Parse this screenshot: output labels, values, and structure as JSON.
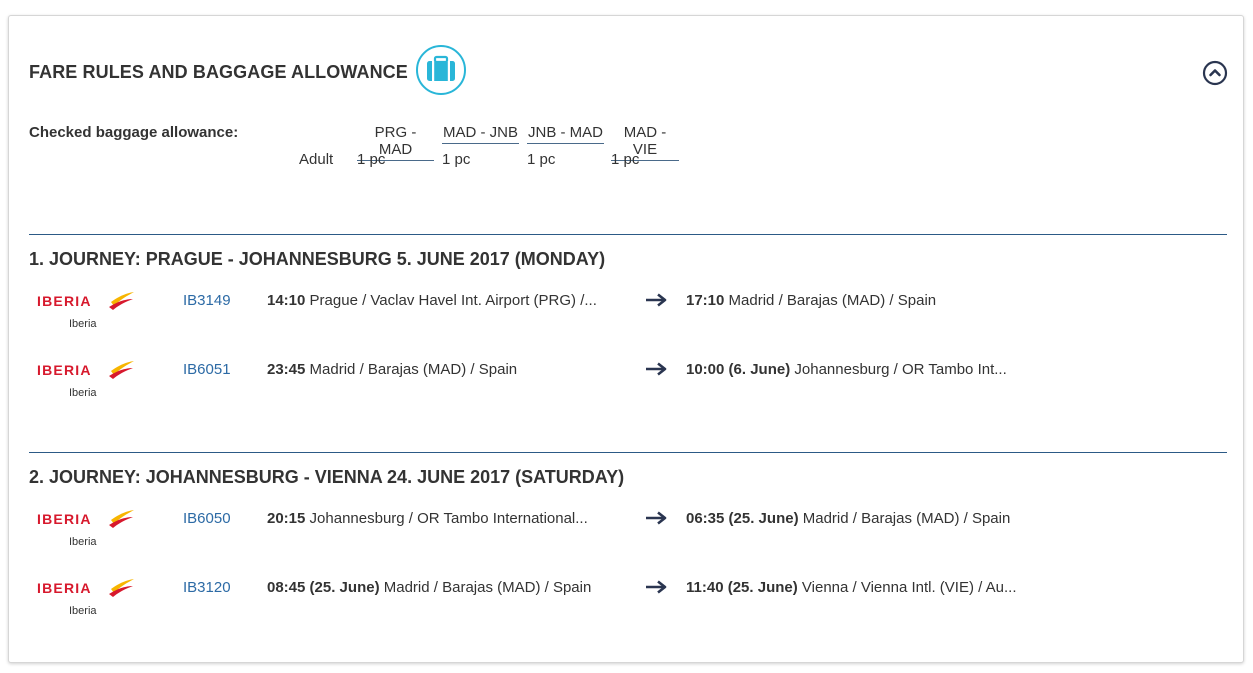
{
  "header": {
    "title": "FARE RULES AND BAGGAGE ALLOWANCE"
  },
  "baggage": {
    "label": "Checked baggage allowance:",
    "passenger_type": "Adult",
    "segments": [
      {
        "route": "PRG - MAD",
        "allowance": "1 pc"
      },
      {
        "route": "MAD - JNB",
        "allowance": "1 pc"
      },
      {
        "route": "JNB - MAD",
        "allowance": "1 pc"
      },
      {
        "route": "MAD - VIE",
        "allowance": "1 pc"
      }
    ]
  },
  "journeys": [
    {
      "title": "1. JOURNEY: PRAGUE - JOHANNESBURG 5. JUNE 2017 (MONDAY)",
      "flights": [
        {
          "airline_logo_text": "IBERIA",
          "airline": "Iberia",
          "number": "IB3149",
          "dep_time": "14:10",
          "dep_date": "",
          "dep_place": "Prague / Vaclav Havel Int. Airport (PRG) /...",
          "arr_time": "17:10",
          "arr_date": "",
          "arr_place": "Madrid / Barajas (MAD) / Spain"
        },
        {
          "airline_logo_text": "IBERIA",
          "airline": "Iberia",
          "number": "IB6051",
          "dep_time": "23:45",
          "dep_date": "",
          "dep_place": "Madrid / Barajas (MAD) / Spain",
          "arr_time": "10:00",
          "arr_date": "(6. June)",
          "arr_place": "Johannesburg / OR Tambo Int..."
        }
      ]
    },
    {
      "title": "2. JOURNEY: JOHANNESBURG - VIENNA 24. JUNE 2017 (SATURDAY)",
      "flights": [
        {
          "airline_logo_text": "IBERIA",
          "airline": "Iberia",
          "number": "IB6050",
          "dep_time": "20:15",
          "dep_date": "",
          "dep_place": "Johannesburg / OR Tambo International...",
          "arr_time": "06:35",
          "arr_date": "(25. June)",
          "arr_place": "Madrid / Barajas (MAD) / Spain"
        },
        {
          "airline_logo_text": "IBERIA",
          "airline": "Iberia",
          "number": "IB3120",
          "dep_time": "08:45",
          "dep_date": "(25. June)",
          "dep_place": "Madrid / Barajas (MAD) / Spain",
          "arr_time": "11:40",
          "arr_date": "(25. June)",
          "arr_place": "Vienna / Vienna Intl. (VIE) / Au..."
        }
      ]
    }
  ],
  "icons": {
    "baggage": "suitcase-icon",
    "collapse": "chevron-up-circle-icon",
    "arrow": "arrow-right-icon"
  },
  "colors": {
    "accent_cyan": "#29b6d8",
    "divider_blue": "#2c5a86",
    "link_blue": "#2c6aa5",
    "iberia_red": "#d7192d",
    "iberia_yellow": "#f7b500"
  }
}
